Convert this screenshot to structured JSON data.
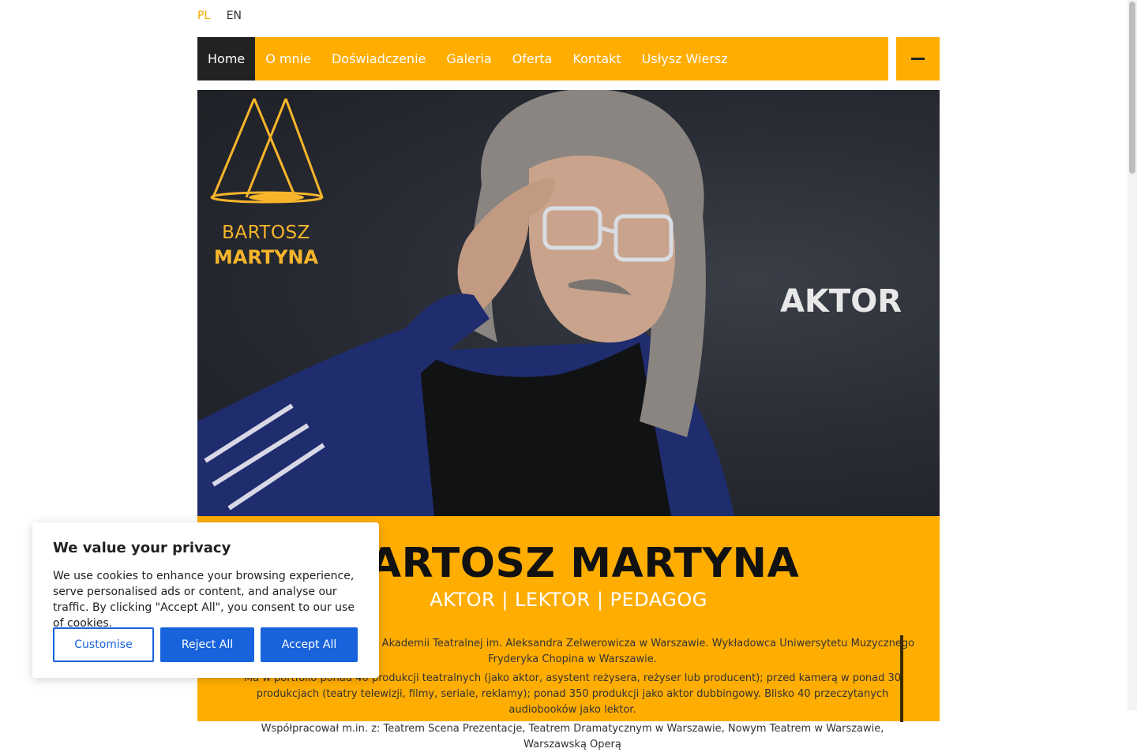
{
  "lang": {
    "pl": "PL",
    "en": "EN"
  },
  "nav": {
    "items": [
      "Home",
      "O mnie",
      "Doświadczenie",
      "Galeria",
      "Oferta",
      "Kontakt",
      "Usłysz Wiersz"
    ],
    "active": "Home",
    "menu_icon": "minus-icon"
  },
  "hero": {
    "logo_line1": "BARTOSZ",
    "logo_line2": "MARTYNA",
    "title": "AKTOR"
  },
  "info": {
    "name": "BARTOSZ MARTYNA",
    "roles": "AKTOR | LEKTOR | PEDAGOG",
    "bio_1": "owca akademicki. Absolwent Akademii Teatralnej im. Aleksandra Zelwerowicza w Warszawie. Wykładowca Uniwersytetu Muzycznego Fryderyka Chopina w Warszawie.",
    "bio_2": "Ma w portfolio ponad 40 produkcji teatralnych (jako aktor, asystent reżysera, reżyser lub producent); przed kamerą w ponad 30 produkcjach (teatry telewizji, filmy, seriale, reklamy); ponad 350 produkcji jako aktor dubbingowy. Blisko 40 przeczytanych audiobooków jako lektor.",
    "bio_3": "Współpracował m.in. z: Teatrem Scena Prezentacje, Teatrem Dramatycznym w Warszawie, Nowym Teatrem w Warszawie, Warszawską Operą"
  },
  "cookie": {
    "title": "We value your privacy",
    "text": "We use cookies to enhance your browsing experience, serve personalised ads or content, and analyse our traffic. By clicking \"Accept All\", you consent to our use of cookies.",
    "customise": "Customise",
    "reject": "Reject All",
    "accept": "Accept All"
  },
  "colors": {
    "accent": "#ffad00",
    "nav_active": "#222222",
    "button_blue": "#1863dc"
  }
}
